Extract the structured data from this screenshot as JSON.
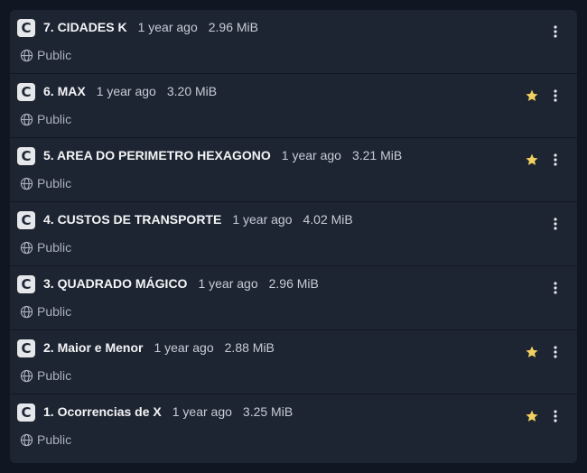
{
  "items": [
    {
      "title": "7. CIDADES K",
      "age": "1 year ago",
      "size": "2.96 MiB",
      "visibility": "Public",
      "starred": false
    },
    {
      "title": "6. MAX",
      "age": "1 year ago",
      "size": "3.20 MiB",
      "visibility": "Public",
      "starred": true
    },
    {
      "title": "5. AREA DO PERIMETRO HEXAGONO",
      "age": "1 year ago",
      "size": "3.21 MiB",
      "visibility": "Public",
      "starred": true
    },
    {
      "title": "4. CUSTOS DE TRANSPORTE",
      "age": "1 year ago",
      "size": "4.02 MiB",
      "visibility": "Public",
      "starred": false
    },
    {
      "title": "3. QUADRADO MÁGICO",
      "age": "1 year ago",
      "size": "2.96 MiB",
      "visibility": "Public",
      "starred": false
    },
    {
      "title": "2. Maior e Menor",
      "age": "1 year ago",
      "size": "2.88 MiB",
      "visibility": "Public",
      "starred": true
    },
    {
      "title": "1. Ocorrencias de X",
      "age": "1 year ago",
      "size": "3.25 MiB",
      "visibility": "Public",
      "starred": true
    }
  ],
  "icons": {
    "logo": "c-language-icon",
    "visibility": "globe-icon",
    "favorite": "star-icon",
    "menu": "more-vertical-icon"
  },
  "colors": {
    "background": "#101622",
    "panel": "#1e2532",
    "star": "#f2d160",
    "title": "#f3f4f6"
  }
}
